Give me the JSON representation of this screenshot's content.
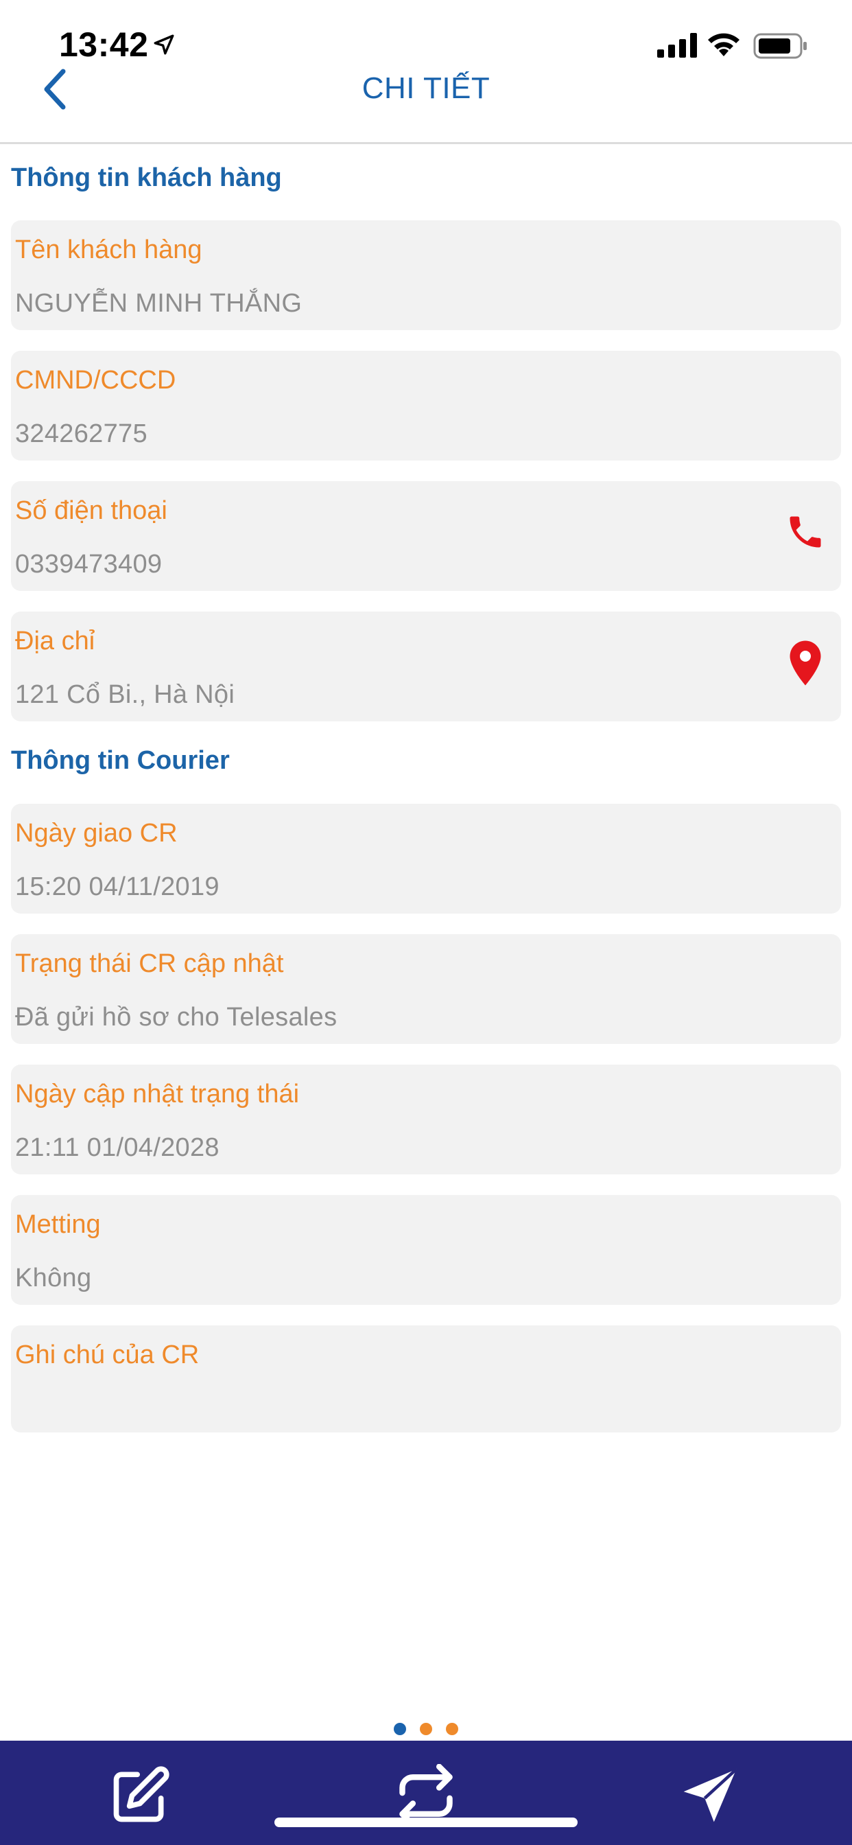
{
  "status_bar": {
    "time": "13:42"
  },
  "nav": {
    "title": "CHI TIẾT"
  },
  "sections": {
    "customer_title": "Thông tin khách hàng",
    "courier_title": "Thông tin Courier"
  },
  "customer": {
    "name_label": "Tên khách hàng",
    "name_value": "NGUYỄN MINH THẮNG",
    "id_label": "CMND/CCCD",
    "id_value": "324262775",
    "phone_label": "Số điện thoại",
    "phone_value": "0339473409",
    "address_label": "Địa chỉ",
    "address_value": "121 Cổ Bi., Hà Nội"
  },
  "courier": {
    "delivery_date_label": "Ngày giao CR",
    "delivery_date_value": "15:20 04/11/2019",
    "status_label": "Trạng thái CR cập nhật",
    "status_value": "Đã gửi hồ sơ cho Telesales",
    "status_date_label": "Ngày cập nhật trạng thái",
    "status_date_value": "21:11 01/04/2028",
    "meeting_label": "Metting",
    "meeting_value": "Không",
    "note_label": "Ghi chú của CR",
    "note_value": ""
  },
  "pagination": {
    "count": 3,
    "active": 1
  },
  "tab_bar": {
    "icons": [
      "edit-icon",
      "transfer-icon",
      "send-icon"
    ]
  },
  "colors": {
    "primary_blue": "#1a63ad",
    "label_orange": "#ef8a2b",
    "value_gray": "#8e8e8e",
    "card_bg": "#f2f2f2",
    "icon_red": "#e5161d",
    "tab_bar_bg": "#26267c"
  }
}
